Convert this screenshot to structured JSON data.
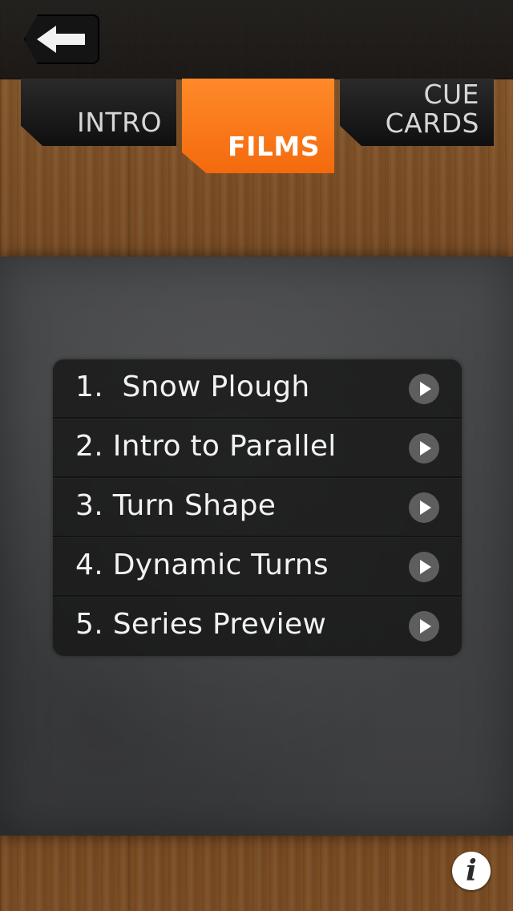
{
  "header": {
    "back_icon": "back-arrow-icon"
  },
  "tabs": [
    {
      "label": "INTRO",
      "selected": false
    },
    {
      "label": "FILMS",
      "selected": true
    },
    {
      "label": "CUE\nCARDS",
      "selected": false
    }
  ],
  "films": [
    {
      "label": "1.  Snow Plough",
      "icon": "play-icon"
    },
    {
      "label": "2. Intro to Parallel",
      "icon": "play-icon"
    },
    {
      "label": "3. Turn Shape",
      "icon": "play-icon"
    },
    {
      "label": "4. Dynamic Turns",
      "icon": "play-icon"
    },
    {
      "label": "5. Series Preview",
      "icon": "play-icon"
    }
  ],
  "footer": {
    "info_label": "i",
    "info_icon": "info-icon"
  },
  "colors": {
    "accent": "#f46a0d",
    "tab_dark": "#141414",
    "board": "#444547"
  }
}
